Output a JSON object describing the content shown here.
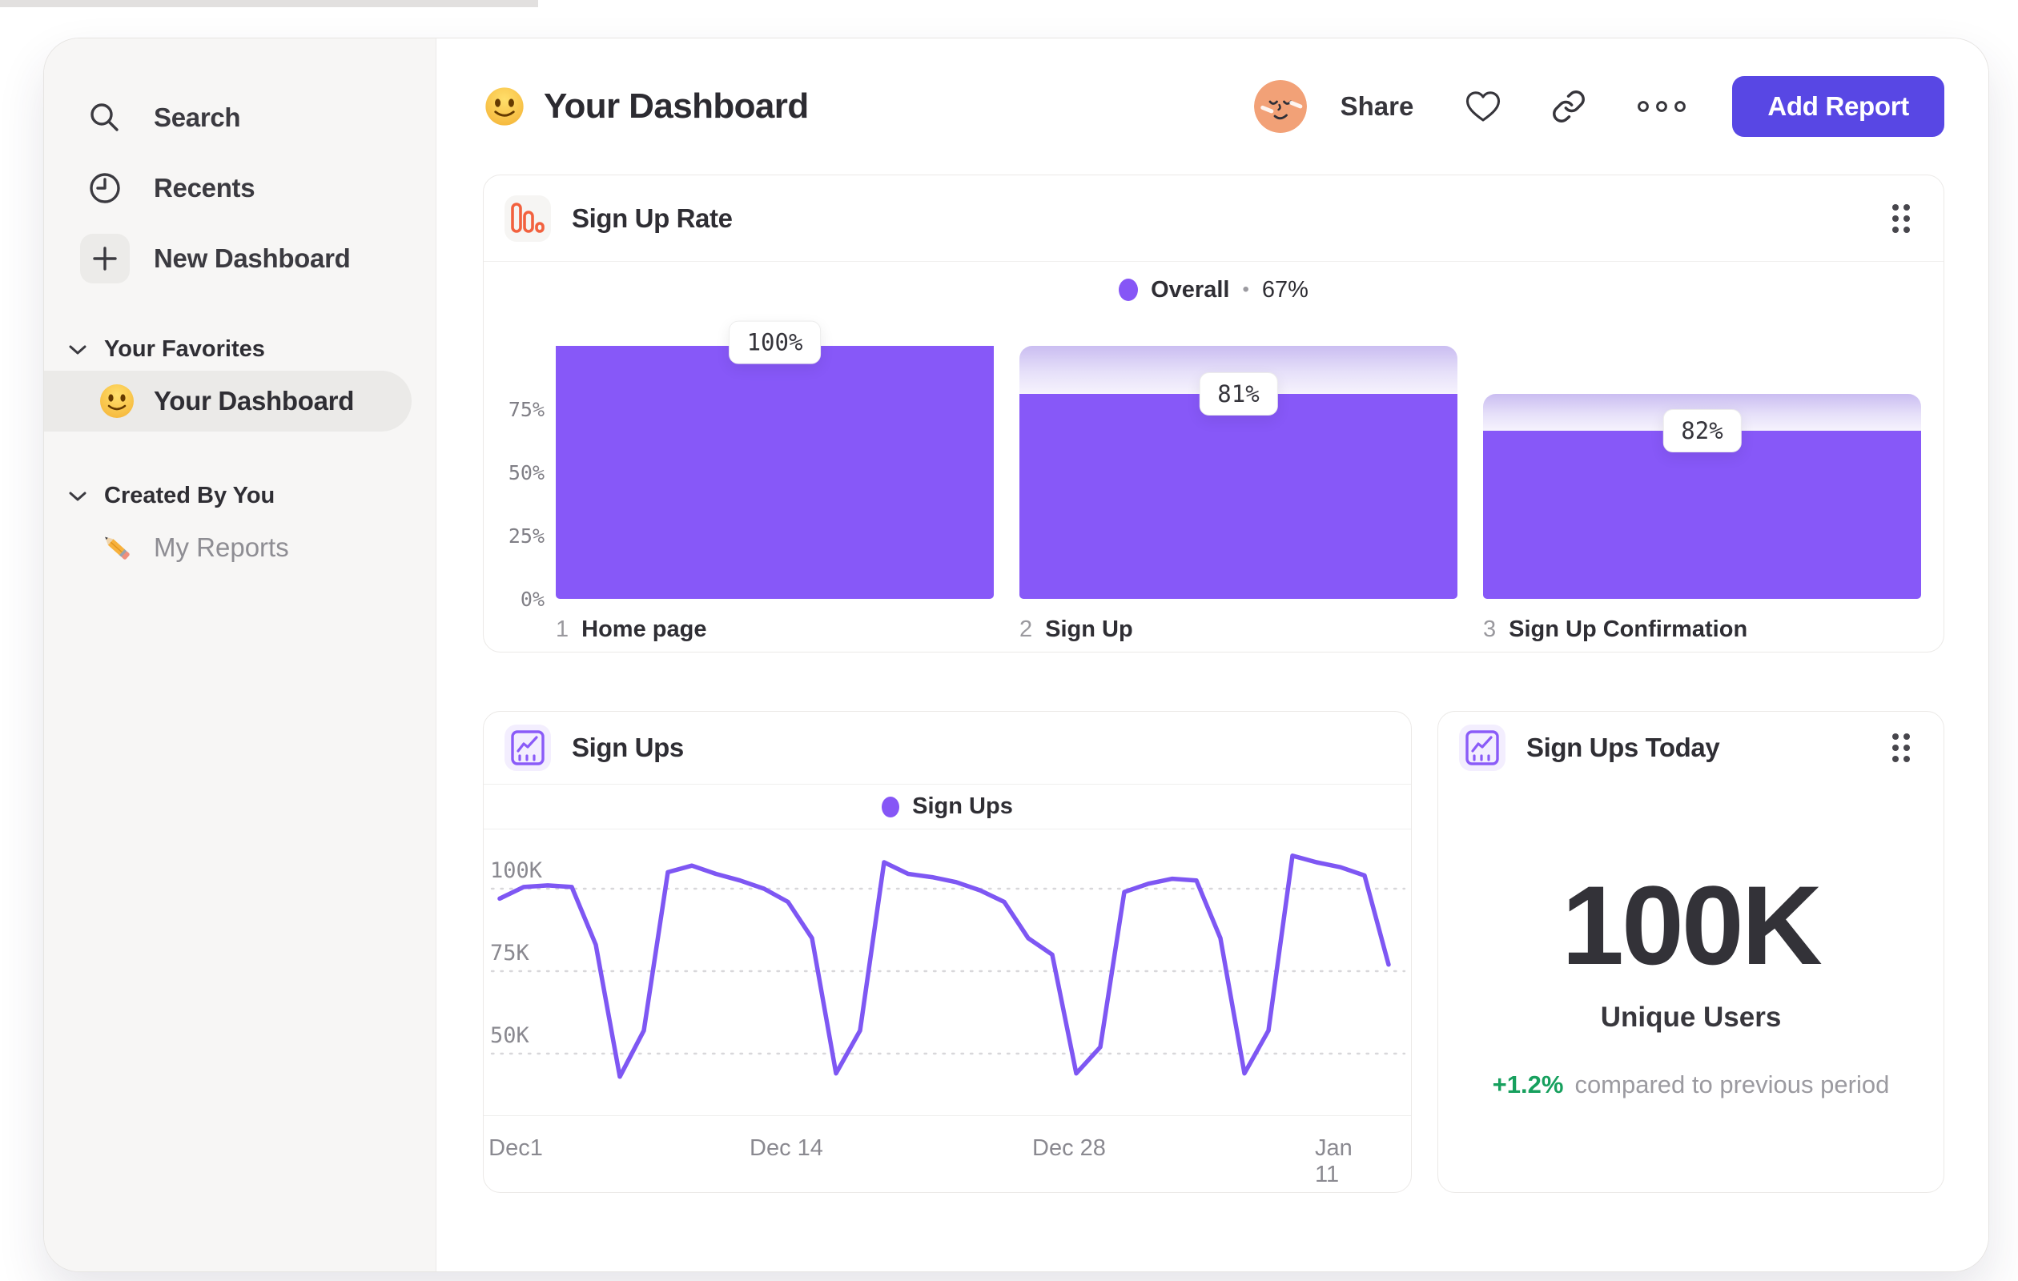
{
  "header": {
    "title": "Your Dashboard",
    "share_label": "Share",
    "add_report_label": "Add Report"
  },
  "sidebar": {
    "primary": [
      {
        "icon": "search-icon",
        "label": "Search"
      },
      {
        "icon": "clock-icon",
        "label": "Recents"
      },
      {
        "icon": "plus-icon",
        "label": "New Dashboard"
      }
    ],
    "sections": [
      {
        "header": "Your Favorites",
        "items": [
          {
            "icon": "smiley-emoji",
            "label": "Your Dashboard",
            "selected": true
          }
        ]
      },
      {
        "header": "Created By You",
        "items": [
          {
            "icon": "pencil-emoji",
            "label": "My Reports",
            "selected": false
          }
        ]
      }
    ]
  },
  "colors": {
    "accent_purple": "#8656F6",
    "button_indigo": "#5847E4",
    "icon_orange": "#F2613E",
    "positive_green": "#17A05E",
    "sidebar_bg": "#f7f6f5",
    "selected_pill": "#ebeae8"
  },
  "chart_data": [
    {
      "id": "signup_rate",
      "type": "bar",
      "title": "Sign Up Rate",
      "legend_name": "Overall",
      "legend_sep": "•",
      "legend_value": "67%",
      "y_ticks": [
        "75%",
        "50%",
        "25%",
        "0%"
      ],
      "ylim": [
        0,
        100
      ],
      "steps": [
        {
          "num": "1",
          "name": "Home page",
          "pct": "100%"
        },
        {
          "num": "2",
          "name": "Sign Up",
          "pct": "81%"
        },
        {
          "num": "3",
          "name": "Sign Up Confirmation",
          "pct": "82%"
        }
      ],
      "step_conversion_pct": [
        100,
        81,
        82
      ],
      "absolute_pct": [
        100,
        81,
        66.4
      ]
    },
    {
      "id": "sign_ups",
      "type": "line",
      "title": "Sign Ups",
      "legend": "Sign Ups",
      "y_ticks": [
        {
          "label": "100K",
          "value": 100
        },
        {
          "label": "75K",
          "value": 75
        },
        {
          "label": "50K",
          "value": 50
        }
      ],
      "x_ticks": [
        {
          "label": "Dec1",
          "x": 40
        },
        {
          "label": "Dec 14",
          "x": 378
        },
        {
          "label": "Dec 28",
          "x": 731
        },
        {
          "label": "Jan 11",
          "x": 1078
        }
      ],
      "unit": "K",
      "values": [
        97,
        100.5,
        101,
        100.5,
        83,
        43,
        57,
        105,
        107,
        104.5,
        102.5,
        100,
        96,
        85,
        44,
        57,
        108,
        104.5,
        103.5,
        102,
        99.5,
        96,
        85,
        80,
        44,
        52,
        99,
        101.5,
        103,
        102.5,
        85,
        44,
        57,
        110,
        108,
        106.5,
        104,
        77
      ]
    },
    {
      "id": "sign_ups_today",
      "type": "metric",
      "title": "Sign Ups Today",
      "value": "100K",
      "label": "Unique Users",
      "delta": "+1.2%",
      "delta_caption": "compared to previous period"
    }
  ]
}
